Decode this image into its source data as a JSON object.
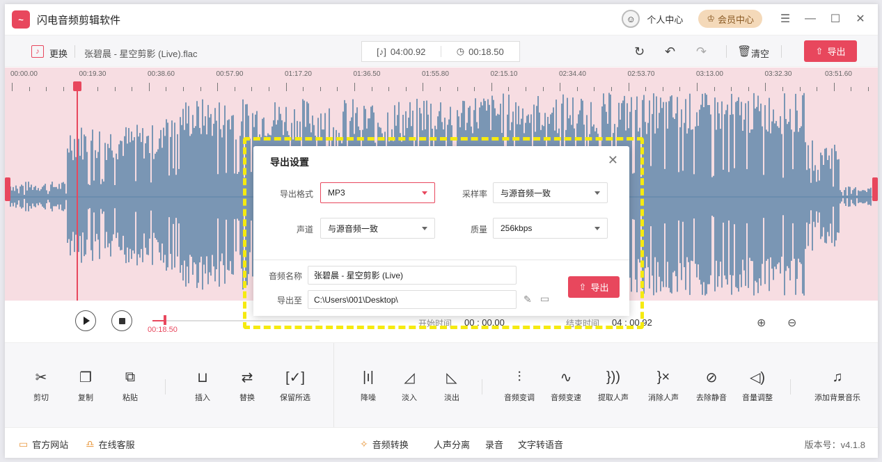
{
  "app": {
    "logo_glyph": "~",
    "title": "闪电音频剪辑软件",
    "profile_label": "个人中心",
    "vip_label": "会员中心"
  },
  "filebar": {
    "replace_label": "更换",
    "file_name": "张碧晨 - 星空剪影 (Live).flac",
    "total_duration": "04:00.92",
    "selected_duration": "00:18.50",
    "clear_label": "清空",
    "export_label": "导出"
  },
  "ruler": {
    "ticks": [
      "00:00.00",
      "00:19.30",
      "00:38.60",
      "00:57.90",
      "01:17.20",
      "01:36.50",
      "01:55.80",
      "02:15.10",
      "02:34.40",
      "02:53.70",
      "03:13.00",
      "03:32.30",
      "03:51.60"
    ]
  },
  "transport": {
    "current_time": "00:18.50",
    "start_label": "开始时间",
    "start_value": "00 : 00.00",
    "end_label": "结束时间",
    "end_value": "04 : 00.92"
  },
  "tools": [
    {
      "label": "剪切",
      "icon": "scissors-icon",
      "glyph": "✂"
    },
    {
      "label": "复制",
      "icon": "copy-icon",
      "glyph": "❐"
    },
    {
      "label": "粘贴",
      "icon": "paste-icon",
      "glyph": "⧉"
    },
    {
      "label": "插入",
      "icon": "insert-icon",
      "glyph": "⊔"
    },
    {
      "label": "替换",
      "icon": "replace-icon",
      "glyph": "⇄"
    },
    {
      "label": "保留所选",
      "icon": "keep-selection-icon",
      "glyph": "[✓]"
    },
    {
      "label": "降噪",
      "icon": "denoise-icon",
      "glyph": "|ı|"
    },
    {
      "label": "淡入",
      "icon": "fade-in-icon",
      "glyph": "◿"
    },
    {
      "label": "淡出",
      "icon": "fade-out-icon",
      "glyph": "◺"
    },
    {
      "label": "音频变调",
      "icon": "pitch-icon",
      "glyph": "⫶"
    },
    {
      "label": "音频变速",
      "icon": "speed-icon",
      "glyph": "∿"
    },
    {
      "label": "提取人声",
      "icon": "extract-voice-icon",
      "glyph": "}))"
    },
    {
      "label": "消除人声",
      "icon": "remove-voice-icon",
      "glyph": "}×"
    },
    {
      "label": "去除静音",
      "icon": "remove-silence-icon",
      "glyph": "⊘"
    },
    {
      "label": "音量调整",
      "icon": "volume-icon",
      "glyph": "◁)"
    },
    {
      "label": "添加背景音乐",
      "icon": "bg-music-icon",
      "glyph": "♫"
    }
  ],
  "footer": {
    "website": "官方网站",
    "support": "在线客服",
    "convert": "音频转换",
    "separate": "人声分离",
    "record": "录音",
    "tts": "文字转语音",
    "version": "版本号：v4.1.8"
  },
  "export_dialog": {
    "title": "导出设置",
    "format_label": "导出格式",
    "format_value": "MP3",
    "samplerate_label": "采样率",
    "samplerate_value": "与源音频一致",
    "channel_label": "声道",
    "channel_value": "与源音频一致",
    "quality_label": "质量",
    "quality_value": "256kbps",
    "name_label": "音频名称",
    "name_value": "张碧晨 - 星空剪影 (Live)",
    "path_label": "导出至",
    "path_value": "C:\\Users\\001\\Desktop\\",
    "export_label": "导出"
  },
  "colors": {
    "accent": "#e8475d",
    "wave": "#5b84a8",
    "wave_bg": "#f7dde2",
    "highlight": "#f5ea10"
  }
}
